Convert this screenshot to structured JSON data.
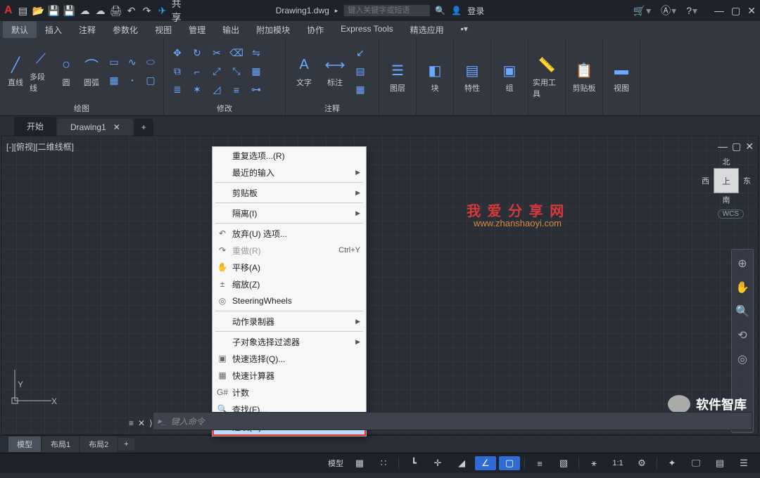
{
  "title": {
    "doc": "Drawing1.dwg",
    "search_ph": "键入关键字或短语",
    "share": "共享",
    "login": "登录"
  },
  "menu": [
    "默认",
    "插入",
    "注释",
    "参数化",
    "视图",
    "管理",
    "输出",
    "附加模块",
    "协作",
    "Express Tools",
    "精选应用"
  ],
  "panels": {
    "draw": {
      "title": "绘图",
      "b1": "直线",
      "b2": "多段线",
      "b3": "圆",
      "b4": "圆弧"
    },
    "modify": {
      "title": "修改"
    },
    "annot": {
      "title": "注释",
      "b1": "文字",
      "b2": "标注"
    },
    "layer": "图层",
    "block": "块",
    "prop": "特性",
    "group": "组",
    "util": "实用工具",
    "clip": "剪贴板",
    "view": "视图"
  },
  "doctabs": {
    "start": "开始",
    "d1": "Drawing1"
  },
  "viewport": {
    "label": "[-][俯视][二维线框]",
    "cube": {
      "n": "北",
      "s": "南",
      "e": "东",
      "w": "西",
      "top": "上"
    },
    "wcs": "WCS"
  },
  "watermark": {
    "l1": "我 爱 分 享 网",
    "l2": "www.zhanshaoyi.com"
  },
  "wechat": "软件智库",
  "context": [
    {
      "t": "重复选项...(R)"
    },
    {
      "t": "最近的输入",
      "sub": true
    },
    {
      "sep": true
    },
    {
      "t": "剪贴板",
      "sub": true
    },
    {
      "sep": true
    },
    {
      "t": "隔离(I)",
      "sub": true
    },
    {
      "sep": true
    },
    {
      "t": "放弃(U) 选项...",
      "ic": "↶"
    },
    {
      "t": "重做(R)",
      "ic": "↷",
      "kb": "Ctrl+Y",
      "dis": true
    },
    {
      "t": "平移(A)",
      "ic": "✋"
    },
    {
      "t": "缩放(Z)",
      "ic": "±"
    },
    {
      "t": "SteeringWheels",
      "ic": "◎"
    },
    {
      "sep": true
    },
    {
      "t": "动作录制器",
      "sub": true
    },
    {
      "sep": true
    },
    {
      "t": "子对象选择过滤器",
      "sub": true
    },
    {
      "t": "快速选择(Q)...",
      "ic": "▣"
    },
    {
      "t": "快速计算器",
      "ic": "▦"
    },
    {
      "t": "计数",
      "ic": "G#"
    },
    {
      "t": "查找(F)...",
      "ic": "🔍"
    },
    {
      "t": "选项(O)...",
      "ic": "☑",
      "hi": true
    }
  ],
  "cmd": {
    "ph": "键入命令"
  },
  "layouts": {
    "model": "模型",
    "l1": "布局1",
    "l2": "布局2"
  },
  "status": {
    "model": "模型",
    "scale": "1:1"
  },
  "axes": {
    "x": "X",
    "y": "Y"
  }
}
